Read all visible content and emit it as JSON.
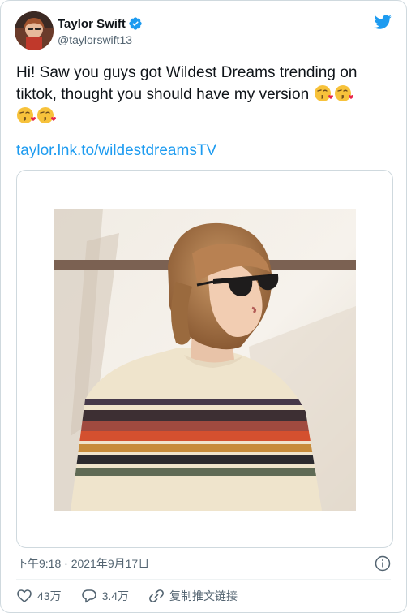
{
  "author": {
    "name": "Taylor Swift",
    "handle": "@taylorswift13"
  },
  "tweet": {
    "text": "Hi! Saw you guys got Wildest Dreams trending on tiktok, thought you should have my version",
    "emojis": [
      "kissing-face-with-heart",
      "kissing-face-with-heart",
      "kissing-face-with-heart",
      "kissing-face-with-heart"
    ],
    "link": "taylor.lnk.to/wildestdreamsTV"
  },
  "meta": {
    "timestamp": "下午9:18 · 2021年9月17日"
  },
  "actions": {
    "likes": "43万",
    "replies": "3.4万",
    "copy_link": "复制推文链接"
  },
  "colors": {
    "accent": "#1d9bf0",
    "text": "#0f1419",
    "muted": "#536471",
    "border": "#cfd9de"
  }
}
